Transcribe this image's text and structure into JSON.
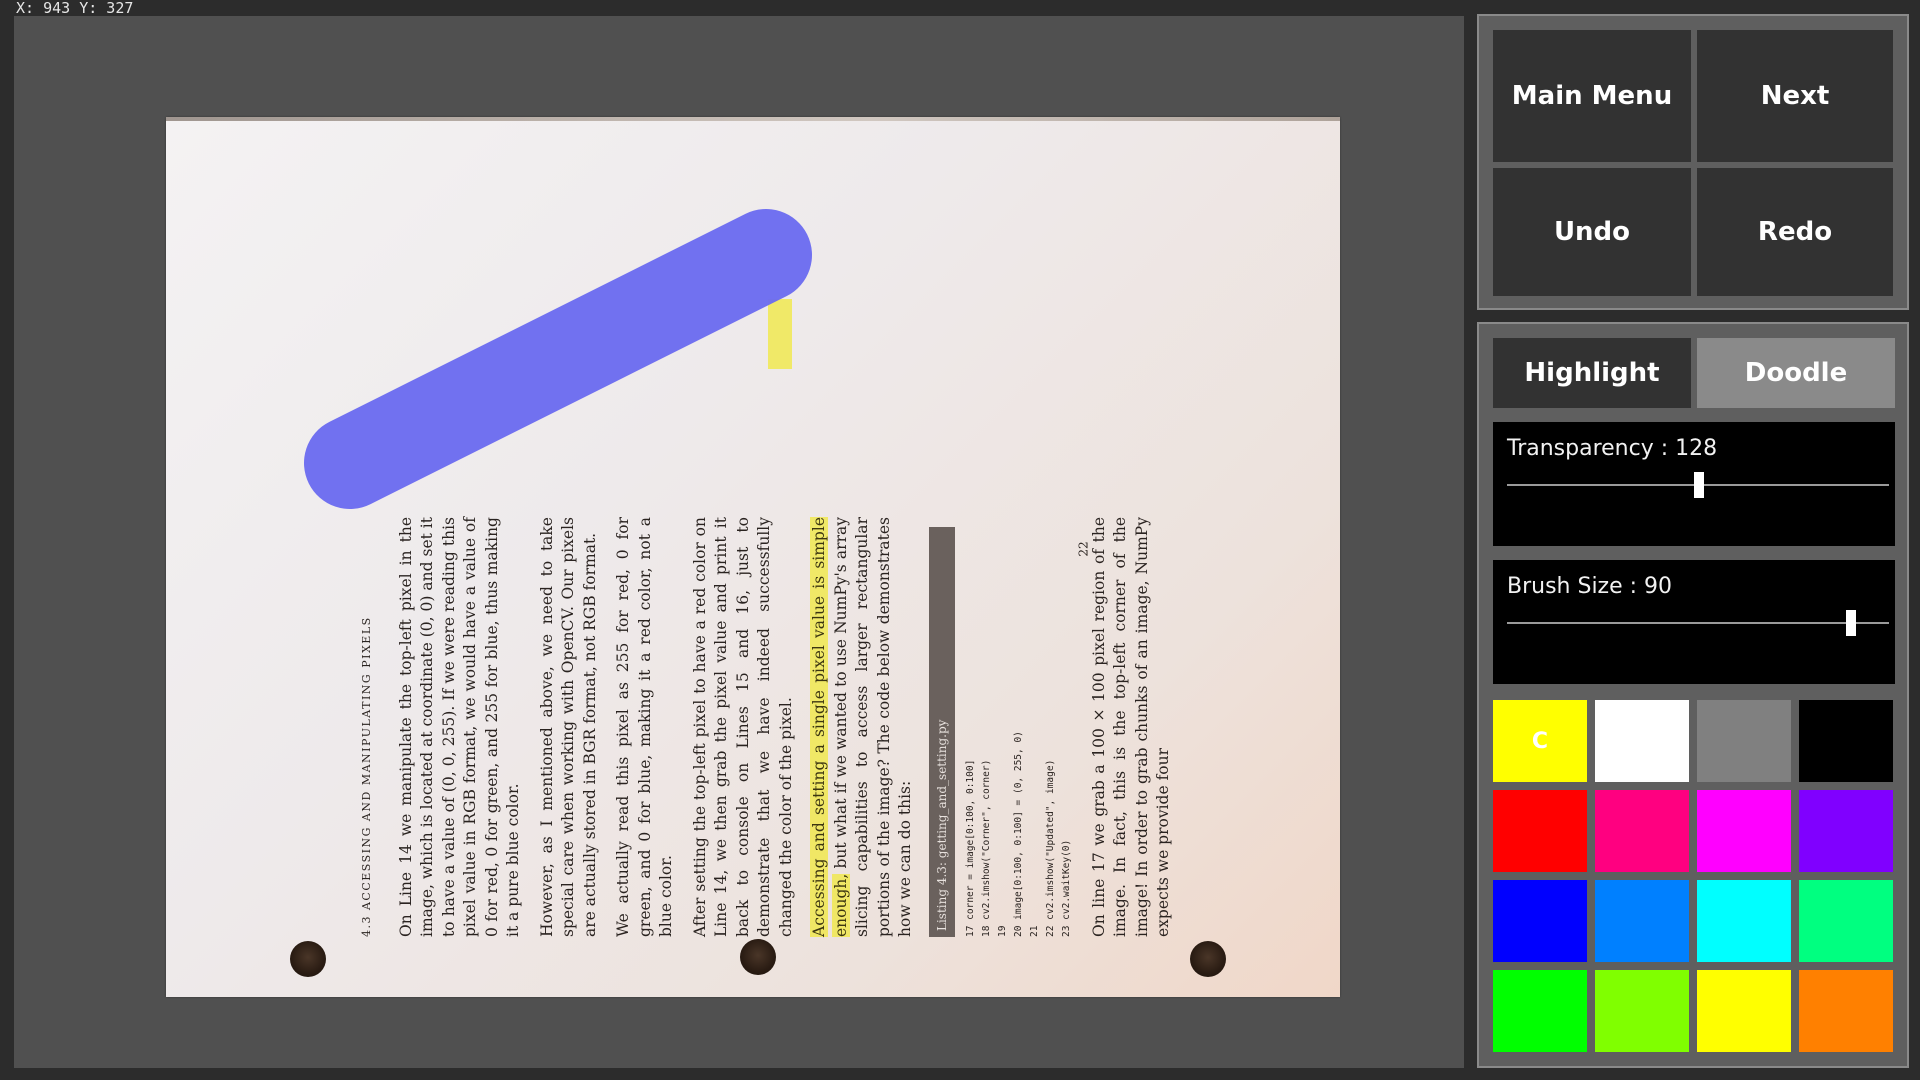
{
  "status": {
    "coords": "X: 943 Y: 327"
  },
  "document": {
    "header": "4.3 accessing and manipulating pixels",
    "paragraphs": [
      "On Line 14 we manipulate the top-left pixel in the image, which is located at coordinate (0, 0) and set it to have a value of (0, 0, 255). If we were reading this pixel value in RGB format, we would have a value of 0 for red, 0 for green, and 255 for blue, thus making it a pure blue color.",
      "However, as I mentioned above, we need to take special care when working with OpenCV. Our pixels are actually stored in BGR format, not RGB format.",
      "We actually read this pixel as 255 for red, 0 for green, and 0 for blue, making it a red color, not a blue color.",
      "After setting the top-left pixel to have a red color on Line 14, we then grab the pixel value and print it back to console on Lines 15 and 16, just to demonstrate that we have indeed successfully changed the color of the pixel."
    ],
    "highlighted_sentence": "Accessing and setting a single pixel value is simple enough,",
    "after_highlight": " but what if we wanted to use NumPy's array slicing capabilities to access larger rectangular portions of the image? The code below demonstrates how we can do this:",
    "listing_title": "Listing 4.3: getting_and_setting.py",
    "code": "17 corner = image[0:100, 0:100]\n18 cv2.imshow(\"Corner\", corner)\n19\n20 image[0:100, 0:100] = (0, 255, 0)\n21\n22 cv2.imshow(\"Updated\", image)\n23 cv2.waitKey(0)",
    "closing": "On line 17 we grab a 100 × 100 pixel region of the image. In fact, this is the top-left corner of the image! In order to grab chunks of an image, NumPy expects we provide four",
    "page_number": "22"
  },
  "nav": {
    "main_menu": "Main  Menu",
    "next": "Next",
    "undo": "Undo",
    "redo": "Redo"
  },
  "tools": {
    "highlight": "Highlight",
    "doodle": "Doodle",
    "active_tool": "Doodle",
    "transparency": {
      "label": "Transparency : 128",
      "value": 128,
      "max": 255
    },
    "brush_size": {
      "label": "Brush Size : 90",
      "value": 90,
      "max": 100
    }
  },
  "palette": {
    "current_label": "C",
    "colors": [
      "#ffff00",
      "#ffffff",
      "#808080",
      "#000000",
      "#ff0000",
      "#ff0080",
      "#ff00ff",
      "#8000ff",
      "#0000ff",
      "#0080ff",
      "#00ffff",
      "#00ff80",
      "#00ff00",
      "#80ff00",
      "#ffff00",
      "#ff8000"
    ]
  },
  "colors": {
    "doodle_stroke": "#6b6bef",
    "highlight": "#f0e83c"
  }
}
